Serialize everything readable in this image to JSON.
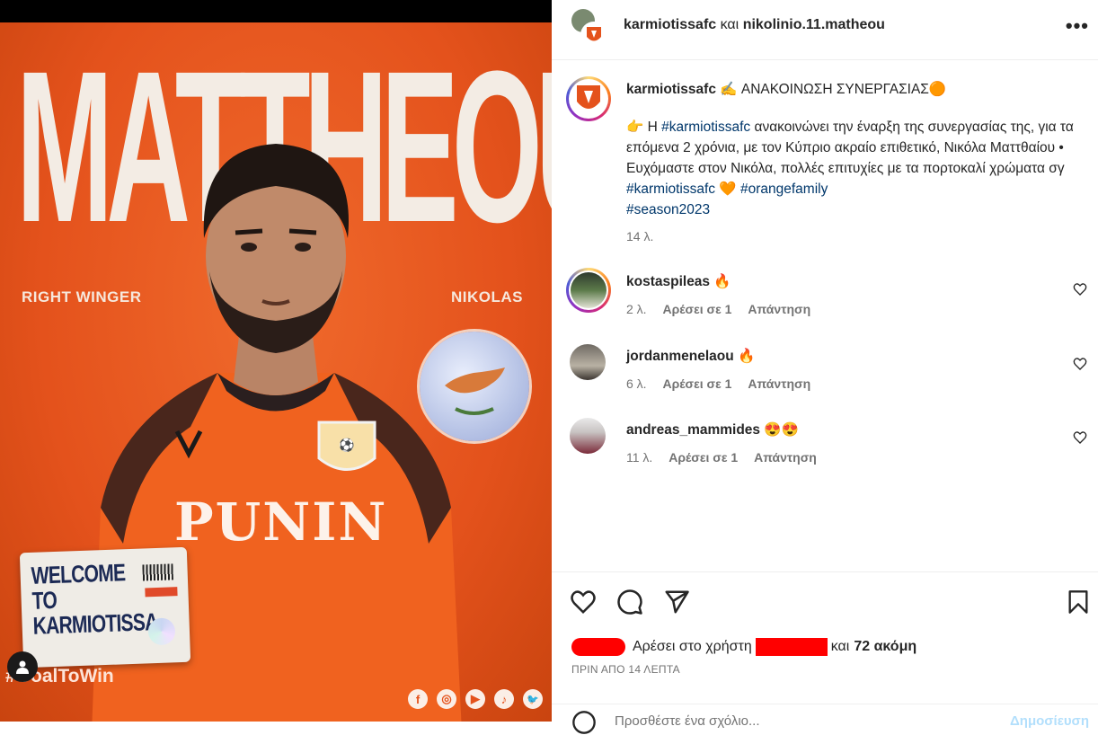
{
  "post_image": {
    "name_text": "MATTHEOU",
    "role": "RIGHT WINGER",
    "first_name": "NIKOLAS",
    "sponsor": "PUNIN",
    "welcome_text": "WELCOME TO KARMIOTISSA",
    "hashtag": "#GoalToWin",
    "socials": [
      "f",
      "◎",
      "▶",
      "♪",
      "🐦"
    ],
    "accent": "#e4521c"
  },
  "header": {
    "account": "karmiotissafc",
    "connector": "και",
    "collaborator": "nikolinio.11.matheou",
    "more": "•••"
  },
  "caption": {
    "username": "karmiotissafc",
    "headline": "✍ ΑΝΑΚΟΙΝΩΣΗ ΣΥΝΕΡΓΑΣΙΑΣ🟠",
    "body_start": "👉 Η ",
    "tag1": "#karmiotissafc",
    "body_mid": " ανακοινώνει την έναρξη της συνεργασίας της, για τα επόμενα 2 χρόνια, με τον Κύπριο ακραίο επιθετικό, Νικόλα Ματτθαίου • Ευχόμαστε στον Νικόλα, πολλές επιτυχίες με τα πορτοκαλί χρώματα σγ ",
    "tag2": "#karmiotissafc",
    "heart": " 🧡 ",
    "tag3": "#orangefamily",
    "tag4": "#season2023",
    "time": "14 λ."
  },
  "comments": [
    {
      "user": "kostaspileas",
      "text": "🔥",
      "time": "2 λ.",
      "likes": "Αρέσει σε 1",
      "reply": "Απάντηση"
    },
    {
      "user": "jordanmenelaou",
      "text": "🔥",
      "time": "6 λ.",
      "likes": "Αρέσει σε 1",
      "reply": "Απάντηση"
    },
    {
      "user": "andreas_mammides",
      "text": "😍😍",
      "time": "11 λ.",
      "likes": "Αρέσει σε 1",
      "reply": "Απάντηση"
    }
  ],
  "footer": {
    "likes_prefix": "Αρέσει στο χρήστη",
    "likes_suffix_pre": "και",
    "likes_suffix": "72 ακόμη",
    "when": "ΠΡΙΝ ΑΠΟ 14 ΛΕΠΤΑ",
    "comment_placeholder": "Προσθέστε ένα σχόλιο...",
    "post_label": "Δημοσίευση"
  }
}
